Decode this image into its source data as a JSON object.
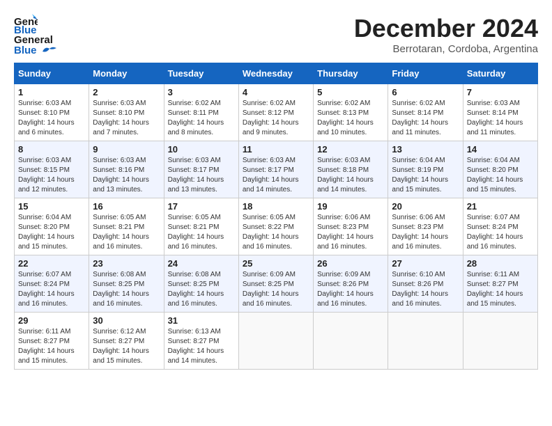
{
  "logo": {
    "line1": "General",
    "line2": "Blue"
  },
  "title": "December 2024",
  "location": "Berrotaran, Cordoba, Argentina",
  "days_of_week": [
    "Sunday",
    "Monday",
    "Tuesday",
    "Wednesday",
    "Thursday",
    "Friday",
    "Saturday"
  ],
  "weeks": [
    [
      {
        "day": "1",
        "sunrise": "6:03 AM",
        "sunset": "8:10 PM",
        "daylight": "14 hours and 6 minutes."
      },
      {
        "day": "2",
        "sunrise": "6:03 AM",
        "sunset": "8:10 PM",
        "daylight": "14 hours and 7 minutes."
      },
      {
        "day": "3",
        "sunrise": "6:02 AM",
        "sunset": "8:11 PM",
        "daylight": "14 hours and 8 minutes."
      },
      {
        "day": "4",
        "sunrise": "6:02 AM",
        "sunset": "8:12 PM",
        "daylight": "14 hours and 9 minutes."
      },
      {
        "day": "5",
        "sunrise": "6:02 AM",
        "sunset": "8:13 PM",
        "daylight": "14 hours and 10 minutes."
      },
      {
        "day": "6",
        "sunrise": "6:02 AM",
        "sunset": "8:14 PM",
        "daylight": "14 hours and 11 minutes."
      },
      {
        "day": "7",
        "sunrise": "6:03 AM",
        "sunset": "8:14 PM",
        "daylight": "14 hours and 11 minutes."
      }
    ],
    [
      {
        "day": "8",
        "sunrise": "6:03 AM",
        "sunset": "8:15 PM",
        "daylight": "14 hours and 12 minutes."
      },
      {
        "day": "9",
        "sunrise": "6:03 AM",
        "sunset": "8:16 PM",
        "daylight": "14 hours and 13 minutes."
      },
      {
        "day": "10",
        "sunrise": "6:03 AM",
        "sunset": "8:17 PM",
        "daylight": "14 hours and 13 minutes."
      },
      {
        "day": "11",
        "sunrise": "6:03 AM",
        "sunset": "8:17 PM",
        "daylight": "14 hours and 14 minutes."
      },
      {
        "day": "12",
        "sunrise": "6:03 AM",
        "sunset": "8:18 PM",
        "daylight": "14 hours and 14 minutes."
      },
      {
        "day": "13",
        "sunrise": "6:04 AM",
        "sunset": "8:19 PM",
        "daylight": "14 hours and 15 minutes."
      },
      {
        "day": "14",
        "sunrise": "6:04 AM",
        "sunset": "8:20 PM",
        "daylight": "14 hours and 15 minutes."
      }
    ],
    [
      {
        "day": "15",
        "sunrise": "6:04 AM",
        "sunset": "8:20 PM",
        "daylight": "14 hours and 15 minutes."
      },
      {
        "day": "16",
        "sunrise": "6:05 AM",
        "sunset": "8:21 PM",
        "daylight": "14 hours and 16 minutes."
      },
      {
        "day": "17",
        "sunrise": "6:05 AM",
        "sunset": "8:21 PM",
        "daylight": "14 hours and 16 minutes."
      },
      {
        "day": "18",
        "sunrise": "6:05 AM",
        "sunset": "8:22 PM",
        "daylight": "14 hours and 16 minutes."
      },
      {
        "day": "19",
        "sunrise": "6:06 AM",
        "sunset": "8:23 PM",
        "daylight": "14 hours and 16 minutes."
      },
      {
        "day": "20",
        "sunrise": "6:06 AM",
        "sunset": "8:23 PM",
        "daylight": "14 hours and 16 minutes."
      },
      {
        "day": "21",
        "sunrise": "6:07 AM",
        "sunset": "8:24 PM",
        "daylight": "14 hours and 16 minutes."
      }
    ],
    [
      {
        "day": "22",
        "sunrise": "6:07 AM",
        "sunset": "8:24 PM",
        "daylight": "14 hours and 16 minutes."
      },
      {
        "day": "23",
        "sunrise": "6:08 AM",
        "sunset": "8:25 PM",
        "daylight": "14 hours and 16 minutes."
      },
      {
        "day": "24",
        "sunrise": "6:08 AM",
        "sunset": "8:25 PM",
        "daylight": "14 hours and 16 minutes."
      },
      {
        "day": "25",
        "sunrise": "6:09 AM",
        "sunset": "8:25 PM",
        "daylight": "14 hours and 16 minutes."
      },
      {
        "day": "26",
        "sunrise": "6:09 AM",
        "sunset": "8:26 PM",
        "daylight": "14 hours and 16 minutes."
      },
      {
        "day": "27",
        "sunrise": "6:10 AM",
        "sunset": "8:26 PM",
        "daylight": "14 hours and 16 minutes."
      },
      {
        "day": "28",
        "sunrise": "6:11 AM",
        "sunset": "8:27 PM",
        "daylight": "14 hours and 15 minutes."
      }
    ],
    [
      {
        "day": "29",
        "sunrise": "6:11 AM",
        "sunset": "8:27 PM",
        "daylight": "14 hours and 15 minutes."
      },
      {
        "day": "30",
        "sunrise": "6:12 AM",
        "sunset": "8:27 PM",
        "daylight": "14 hours and 15 minutes."
      },
      {
        "day": "31",
        "sunrise": "6:13 AM",
        "sunset": "8:27 PM",
        "daylight": "14 hours and 14 minutes."
      },
      null,
      null,
      null,
      null
    ]
  ],
  "labels": {
    "sunrise": "Sunrise:",
    "sunset": "Sunset:",
    "daylight": "Daylight:"
  }
}
